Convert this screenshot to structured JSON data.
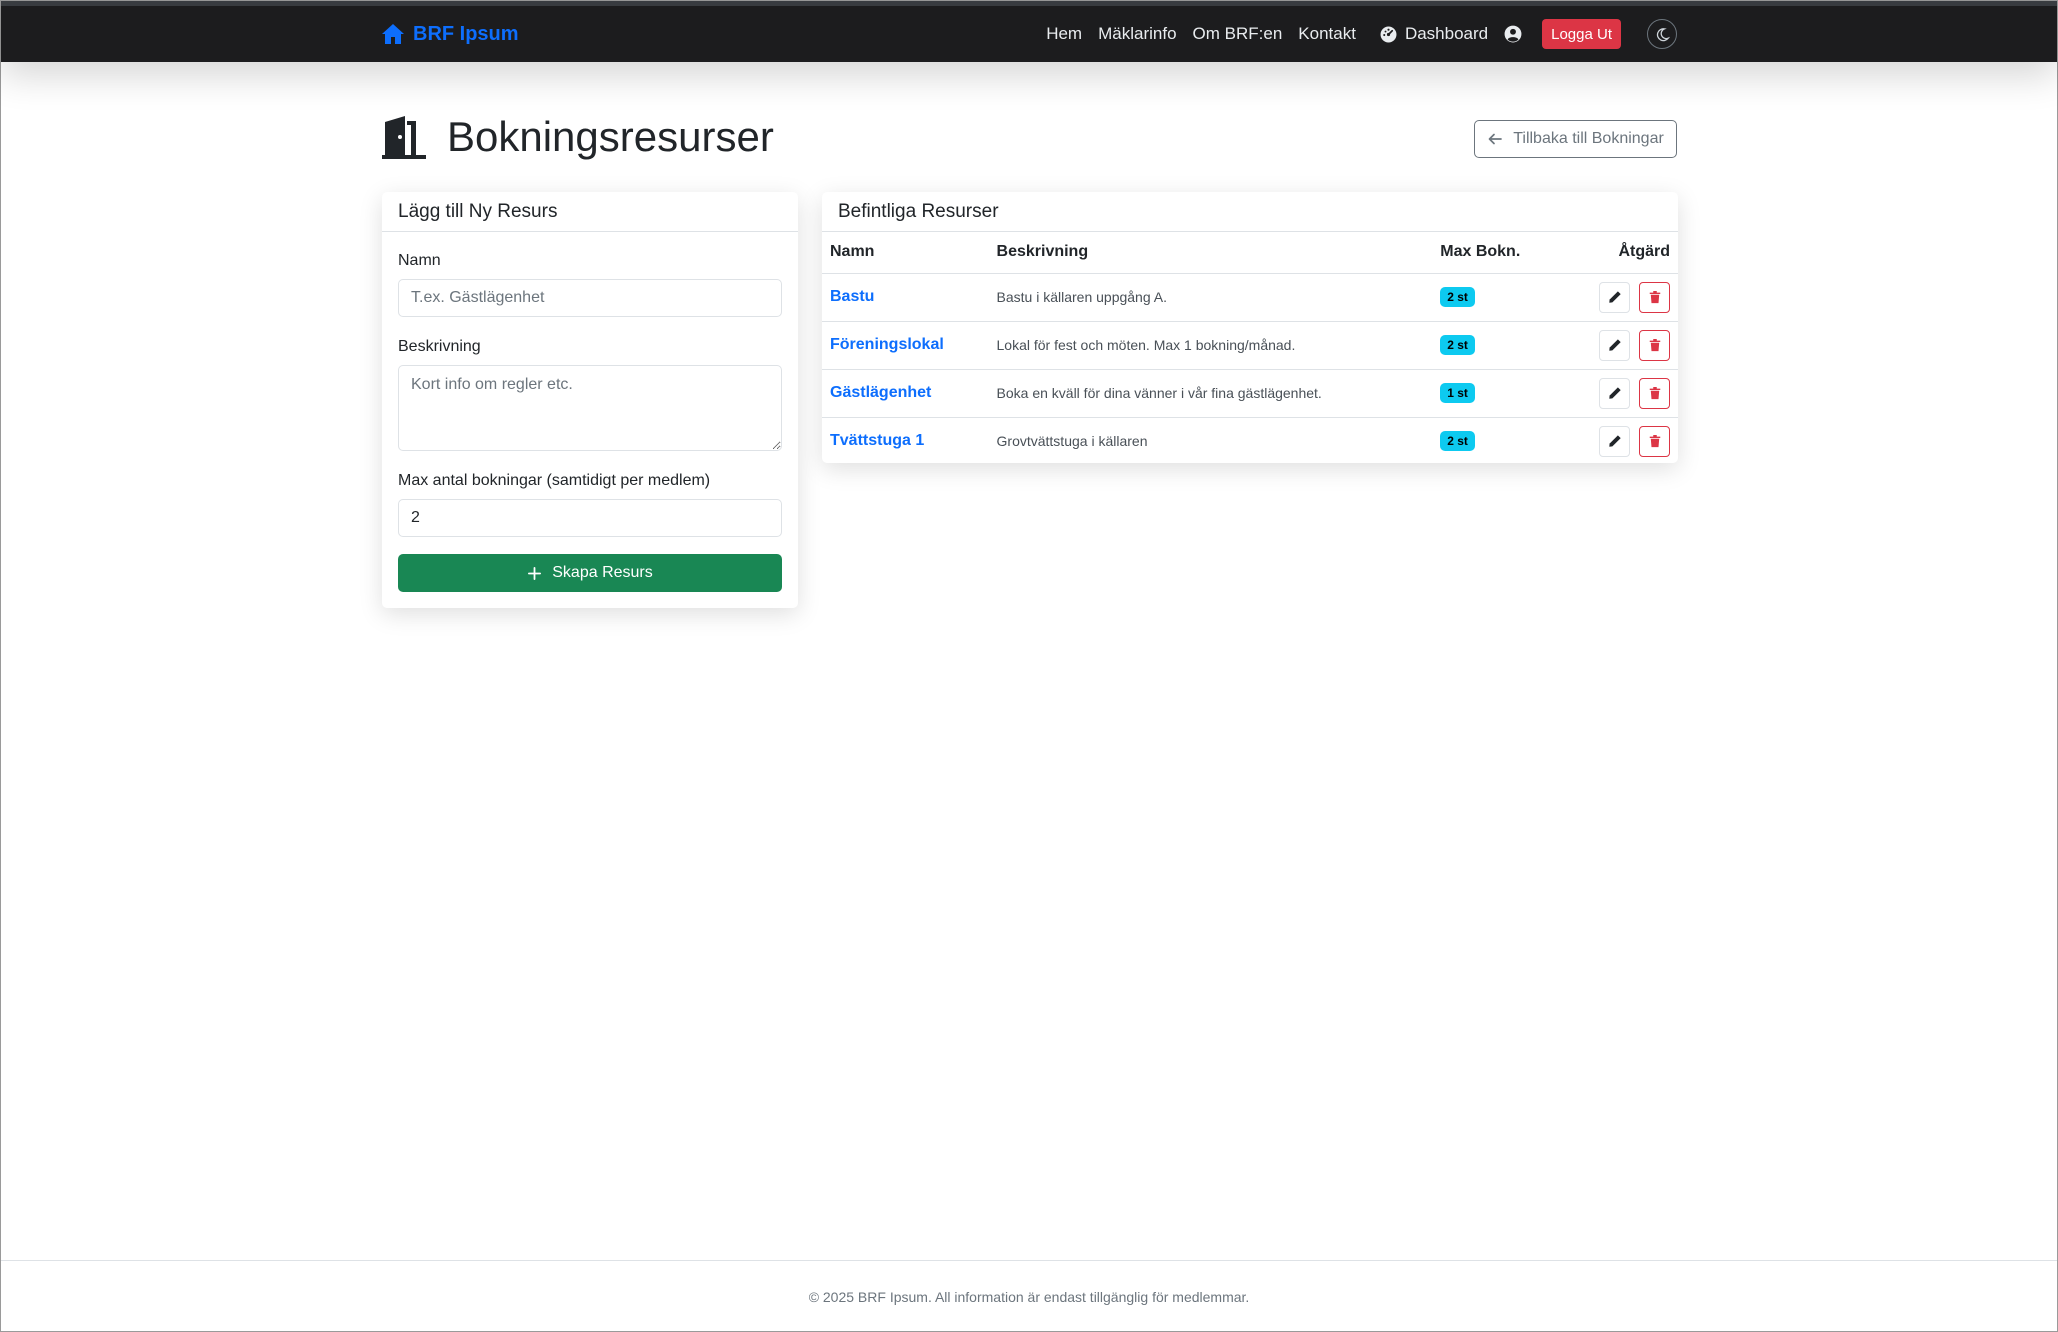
{
  "navbar": {
    "brand": "BRF Ipsum",
    "links": [
      "Hem",
      "Mäklarinfo",
      "Om BRF:en",
      "Kontakt"
    ],
    "dashboard": "Dashboard",
    "logout": "Logga Ut"
  },
  "page": {
    "title": "Bokningsresurser",
    "back_button": "Tillbaka till Bokningar"
  },
  "form": {
    "header": "Lägg till Ny Resurs",
    "name_label": "Namn",
    "name_placeholder": "T.ex. Gästlägenhet",
    "description_label": "Beskrivning",
    "description_placeholder": "Kort info om regler etc.",
    "max_label": "Max antal bokningar (samtidigt per medlem)",
    "max_value": "2",
    "submit": "Skapa Resurs"
  },
  "resources": {
    "header": "Befintliga Resurser",
    "columns": [
      "Namn",
      "Beskrivning",
      "Max Bokn.",
      "Åtgärd"
    ],
    "rows": [
      {
        "name": "Bastu",
        "description": "Bastu i källaren uppgång A.",
        "max": "2 st"
      },
      {
        "name": "Föreningslokal",
        "description": "Lokal för fest och möten. Max 1 bokning/månad.",
        "max": "2 st"
      },
      {
        "name": "Gästlägenhet",
        "description": "Boka en kväll för dina vänner i vår fina gästlägenhet.",
        "max": "1 st"
      },
      {
        "name": "Tvättstuga 1",
        "description": "Grovtvättstuga i källaren",
        "max": "2 st"
      }
    ]
  },
  "footer": {
    "text": "© 2025 BRF Ipsum. All information är endast tillgänglig för medlemmar."
  },
  "colors": {
    "navbar": "#1c1c1e",
    "primary": "#0d6efd",
    "danger": "#dc3545",
    "success": "#198754",
    "info": "#0dcaf0"
  },
  "icons": {
    "brand": "house-icon",
    "dashboard": "speedometer-icon",
    "user": "user-circle-icon",
    "theme": "moon-icon",
    "title": "door-icon",
    "back": "arrow-left-icon",
    "create": "plus-icon",
    "edit": "pencil-icon",
    "delete": "trash-icon"
  }
}
